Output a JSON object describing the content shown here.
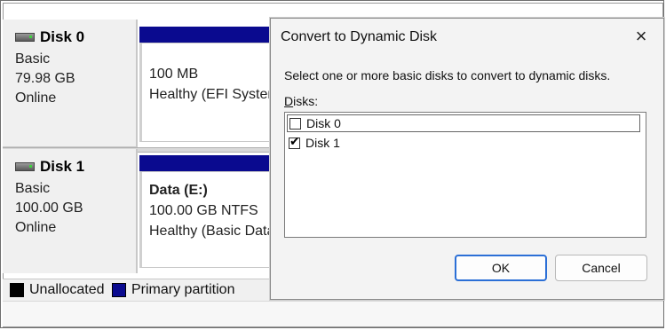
{
  "disks": [
    {
      "name": "Disk 0",
      "type": "Basic",
      "size": "79.98 GB",
      "status": "Online",
      "partition": {
        "name": "",
        "line1": "100 MB",
        "line2": "Healthy (EFI System"
      }
    },
    {
      "name": "Disk 1",
      "type": "Basic",
      "size": "100.00 GB",
      "status": "Online",
      "partition": {
        "name": "Data  (E:)",
        "line1": "100.00 GB NTFS",
        "line2": "Healthy (Basic Data"
      }
    }
  ],
  "legend": [
    {
      "label": "Unallocated",
      "color": "#000000"
    },
    {
      "label": "Primary partition",
      "color": "#0a0a8f"
    }
  ],
  "dialog": {
    "title": "Convert to Dynamic Disk",
    "close_icon": "×",
    "instruction": "Select one or more basic disks to convert to dynamic disks.",
    "list_label_first": "D",
    "list_label_rest": "isks:",
    "items": [
      {
        "label": "Disk 0",
        "checked": false
      },
      {
        "label": "Disk 1",
        "checked": true
      }
    ],
    "ok_label": "OK",
    "cancel_label": "Cancel"
  },
  "colors": {
    "primary_partition": "#0a0a8f",
    "focus": "#2b6fd6"
  }
}
